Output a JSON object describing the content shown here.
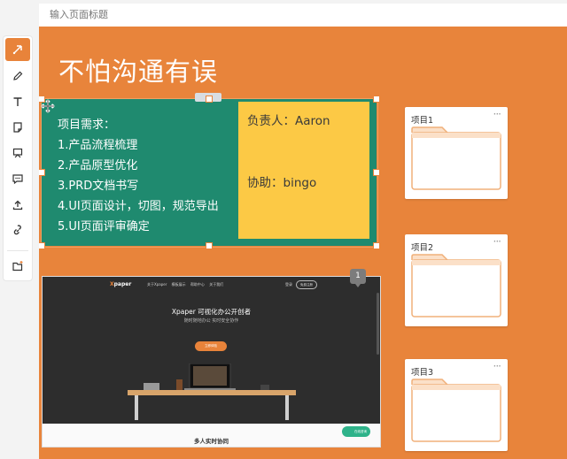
{
  "title_bar": {
    "placeholder": "输入页面标题"
  },
  "board": {
    "title": "不怕沟通有误"
  },
  "toolbar": {
    "tools": [
      {
        "name": "select-tool",
        "icon": "pointer-icon",
        "active": true
      },
      {
        "name": "pen-tool",
        "icon": "pen-icon"
      },
      {
        "name": "text-tool",
        "icon": "text-icon"
      },
      {
        "name": "sticky-note-tool",
        "icon": "sticky-note-icon"
      },
      {
        "name": "board-tool",
        "icon": "board-icon"
      },
      {
        "name": "comment-tool",
        "icon": "comment-icon"
      },
      {
        "name": "upload-tool",
        "icon": "upload-icon"
      },
      {
        "name": "link-tool",
        "icon": "link-icon"
      },
      {
        "name": "new-folder-tool",
        "icon": "new-folder-icon"
      }
    ]
  },
  "green_card": {
    "lines": [
      "项目需求：",
      "1.产品流程梳理",
      "2.产品原型优化",
      "3.PRD文档书写",
      "4.UI页面设计，切图，规范导出",
      "5.UI页面评审确定"
    ]
  },
  "yellow_card": {
    "owner": "负责人：Aaron",
    "assist": "协助：bingo"
  },
  "screenshot_card": {
    "logo": "paper",
    "nav_links": [
      "关于Xpaper",
      "模板展示",
      "帮助中心",
      "关于我们"
    ],
    "login": "登录",
    "register": "免费注册",
    "heading": "Xpaper 可视化办公开创者",
    "subheading": "随时随地办公 实时安全协作",
    "cta": "立即体验",
    "bottom_heading": "多人实时协同",
    "chat": "在线咨询",
    "comment_count": "1"
  },
  "folders": [
    {
      "label": "项目1"
    },
    {
      "label": "项目2"
    },
    {
      "label": "项目3"
    }
  ],
  "colors": {
    "canvas": "#e8843b",
    "green": "#1f8a6f",
    "yellow": "#fcc945",
    "accent": "#e8833a"
  }
}
